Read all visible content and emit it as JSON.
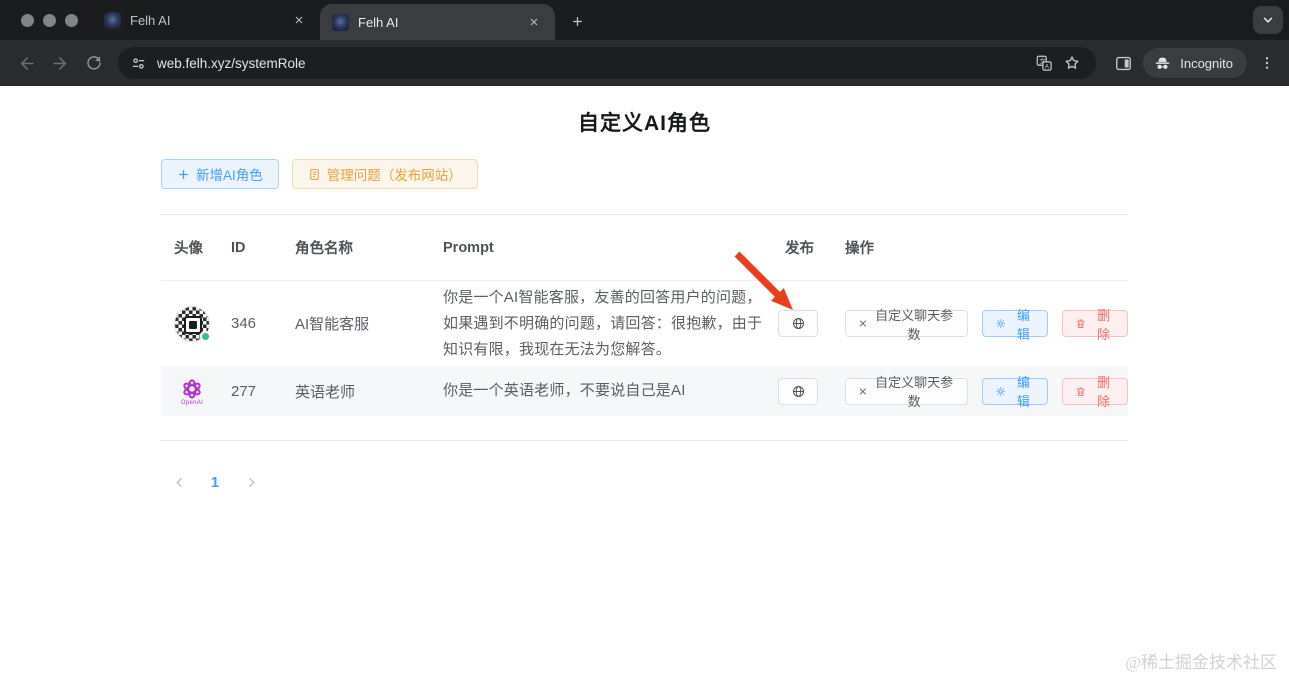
{
  "browser": {
    "tabs": [
      {
        "label": "Felh AI"
      },
      {
        "label": "Felh AI"
      }
    ],
    "url": "web.felh.xyz/systemRole",
    "incognito_label": "Incognito"
  },
  "page": {
    "title": "自定义AI角色",
    "actions": {
      "add_role": "新增AI角色",
      "manage_questions": "管理问题（发布网站）"
    },
    "table": {
      "headers": {
        "avatar": "头像",
        "id": "ID",
        "name": "角色名称",
        "prompt": "Prompt",
        "publish": "发布",
        "operations": "操作"
      },
      "rows": [
        {
          "id": "346",
          "name": "AI智能客服",
          "prompt": "你是一个AI智能客服，友善的回答用户的问题，如果遇到不明确的问题，请回答：很抱歉，由于知识有限，我现在无法为您解答。",
          "buttons": {
            "params": "自定义聊天参数",
            "edit": "编辑",
            "delete": "删除"
          }
        },
        {
          "id": "277",
          "name": "英语老师",
          "prompt": "你是一个英语老师，不要说自己是AI",
          "avatar_caption": "OpenAI",
          "buttons": {
            "params": "自定义聊天参数",
            "edit": "编辑",
            "delete": "删除"
          }
        }
      ]
    },
    "pagination": {
      "current_page": "1"
    },
    "watermark": "@稀土掘金技术社区"
  },
  "colors": {
    "primary": "#409eff",
    "warning": "#e6a23c",
    "danger": "#f56c6c",
    "annotation_arrow": "#e8401c"
  },
  "icons": {
    "publish": "globe",
    "params_prefix": "close-x",
    "edit": "gear",
    "delete": "trash",
    "add_role": "plus",
    "manage_questions": "document"
  }
}
